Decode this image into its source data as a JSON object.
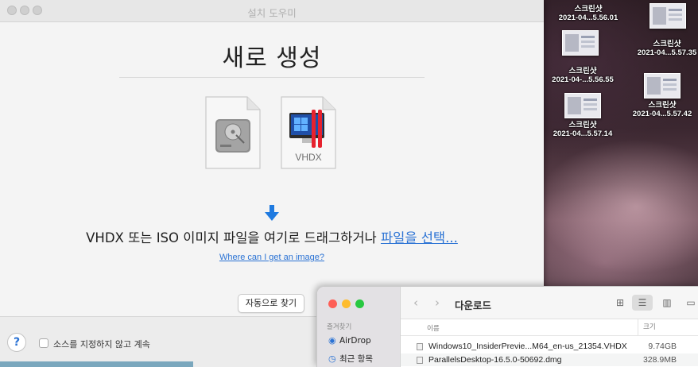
{
  "desktop": {
    "icons": [
      {
        "name": "스크린샷",
        "date": "2021-04...5.56.01"
      },
      {
        "name": "스크린샷",
        "date": "2021-04...5.57.35"
      },
      {
        "name": "스크린샷",
        "date": "2021-04-...5.56.55"
      },
      {
        "name": "스크린샷",
        "date": "2021-04...5.57.42"
      },
      {
        "name": "스크린샷",
        "date": "2021-04...5.57.14"
      }
    ]
  },
  "installer": {
    "window_title": "설치 도우미",
    "heading": "새로 생성",
    "vhdx_label": "VHDX",
    "drop_text": "VHDX 또는 ISO 이미지 파일을 여기로 드래그하거나 ",
    "choose_file_link": "파일을 선택...",
    "help_link": "Where can I get an image?",
    "auto_find_button": "자동으로 찾기",
    "help_button": "?",
    "skip_source_label": "소스를 지정하지 않고 계속"
  },
  "finder": {
    "title": "다운로드",
    "sidebar_section": "즐겨찾기",
    "sidebar_items": [
      {
        "label": "AirDrop",
        "icon": "airdrop-icon"
      },
      {
        "label": "최근 항목",
        "icon": "clock-icon"
      }
    ],
    "columns": {
      "name": "이름",
      "size": "크기"
    },
    "files": [
      {
        "name": "Windows10_InsiderPrevie...M64_en-us_21354.VHDX",
        "size": "9.74GB"
      },
      {
        "name": "ParallelsDesktop-16.5.0-50692.dmg",
        "size": "328.9MB"
      }
    ]
  },
  "colors": {
    "accent": "#2a72d4",
    "close": "#fe5f57",
    "minimize": "#febc2e",
    "zoom": "#28c840"
  }
}
